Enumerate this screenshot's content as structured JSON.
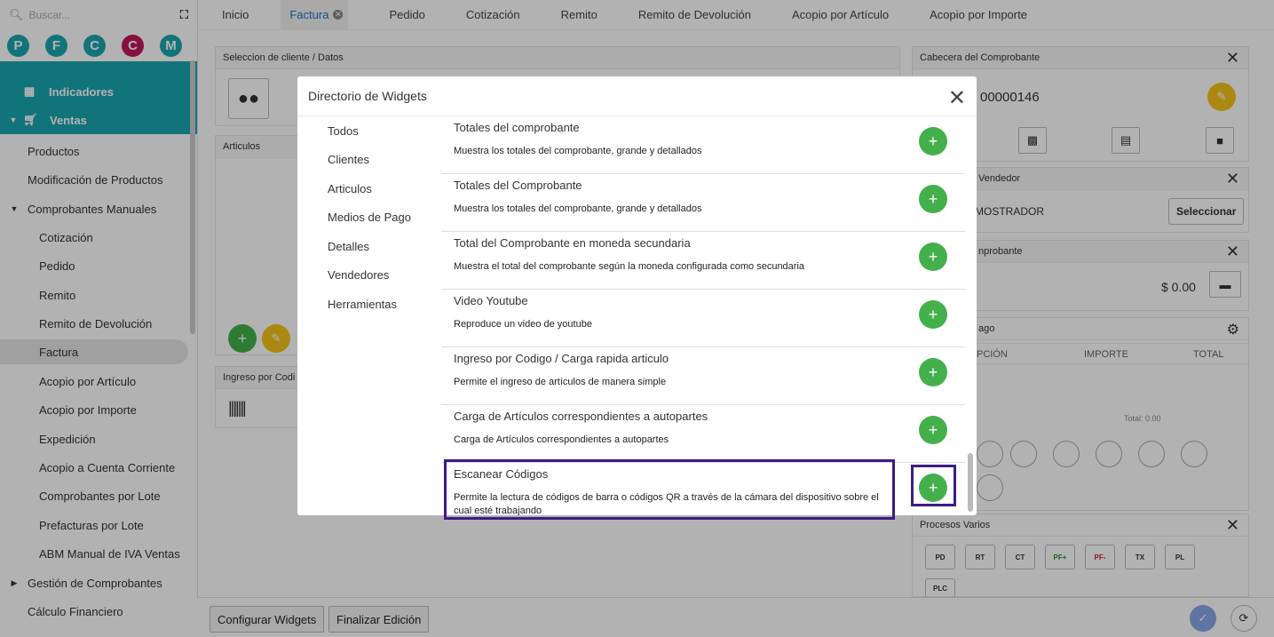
{
  "sidebar": {
    "search_placeholder": "Buscar...",
    "avatars": [
      {
        "letter": "P",
        "color": "#1aa6b1"
      },
      {
        "letter": "F",
        "color": "#1aa6b1"
      },
      {
        "letter": "C",
        "color": "#1aa6b1"
      },
      {
        "letter": "C",
        "color": "#c2185b"
      },
      {
        "letter": "M",
        "color": "#1aa6b1"
      }
    ],
    "indicadores": "Indicadores",
    "ventas": "Ventas",
    "items": [
      "Productos",
      "Modificación de Productos",
      "Comprobantes Manuales",
      "Cotización",
      "Pedido",
      "Remito",
      "Remito de Devolución",
      "Factura",
      "Acopio por Artículo",
      "Acopio por Importe",
      "Expedición",
      "Acopio a Cuenta Corriente",
      "Comprobantes por Lote",
      "Prefacturas por Lote",
      "ABM Manual de IVA Ventas",
      "Gestión de Comprobantes",
      "Cálculo Financiero"
    ]
  },
  "tabs": [
    "Inicio",
    "Factura",
    "Pedido",
    "Cotización",
    "Remito",
    "Remito de Devolución",
    "Acopio por Artículo",
    "Acopio por Importe"
  ],
  "panels": {
    "cliente_title": "Seleccion de cliente / Datos",
    "articulos_title": "Articulos",
    "ingreso_title": "Ingreso por Codi",
    "cabecera_title": "Cabecera del Comprobante",
    "numero": "00000146",
    "vendedor_title": "Vendedor",
    "vendedor_value": "MOSTRADOR",
    "seleccionar": "Seleccionar",
    "comprobante_title": "nprobante",
    "monto": "$ 0.00",
    "pago_title": "ago",
    "col_descripcion": "PCIÓN",
    "col_importe": "IMPORTE",
    "col_total": "TOTAL",
    "total_small": "Total: 0.00",
    "procesos_title": "Procesos Varios",
    "procesos": [
      "PD",
      "RT",
      "CT",
      "PF+",
      "PF-",
      "TX",
      "PL",
      "PLC"
    ]
  },
  "buttons": {
    "configurar": "Configurar Widgets",
    "finalizar": "Finalizar Edición"
  },
  "modal": {
    "title": "Directorio de Widgets",
    "categories": [
      "Todos",
      "Clientes",
      "Articulos",
      "Medios de Pago",
      "Detalles",
      "Vendedores",
      "Herramientas"
    ],
    "widgets": [
      {
        "title": "Totales del comprobante",
        "desc": "Muestra los totales del comprobante, grande y detallados"
      },
      {
        "title": "Totales del Comprobante",
        "desc": "Muestra los totales del comprobante, grande y detallados"
      },
      {
        "title": "Total del Comprobante en moneda secundaria",
        "desc": "Muestra el total del comprobante según la moneda configurada como secundaria"
      },
      {
        "title": "Video Youtube",
        "desc": "Reproduce un video de youtube"
      },
      {
        "title": "Ingreso por Codigo / Carga rapida articulo",
        "desc": "Permite el ingreso de artículos de manera simple"
      },
      {
        "title": "Carga de Artículos correspondientes a autopartes",
        "desc": "Carga de Artículos correspondientes a autopartes"
      },
      {
        "title": "Escanear Códigos",
        "desc": "Permite la lectura de códigos de barra o códigos QR a través de la cámara del dispositivo sobre el cual esté trabajando"
      }
    ]
  }
}
